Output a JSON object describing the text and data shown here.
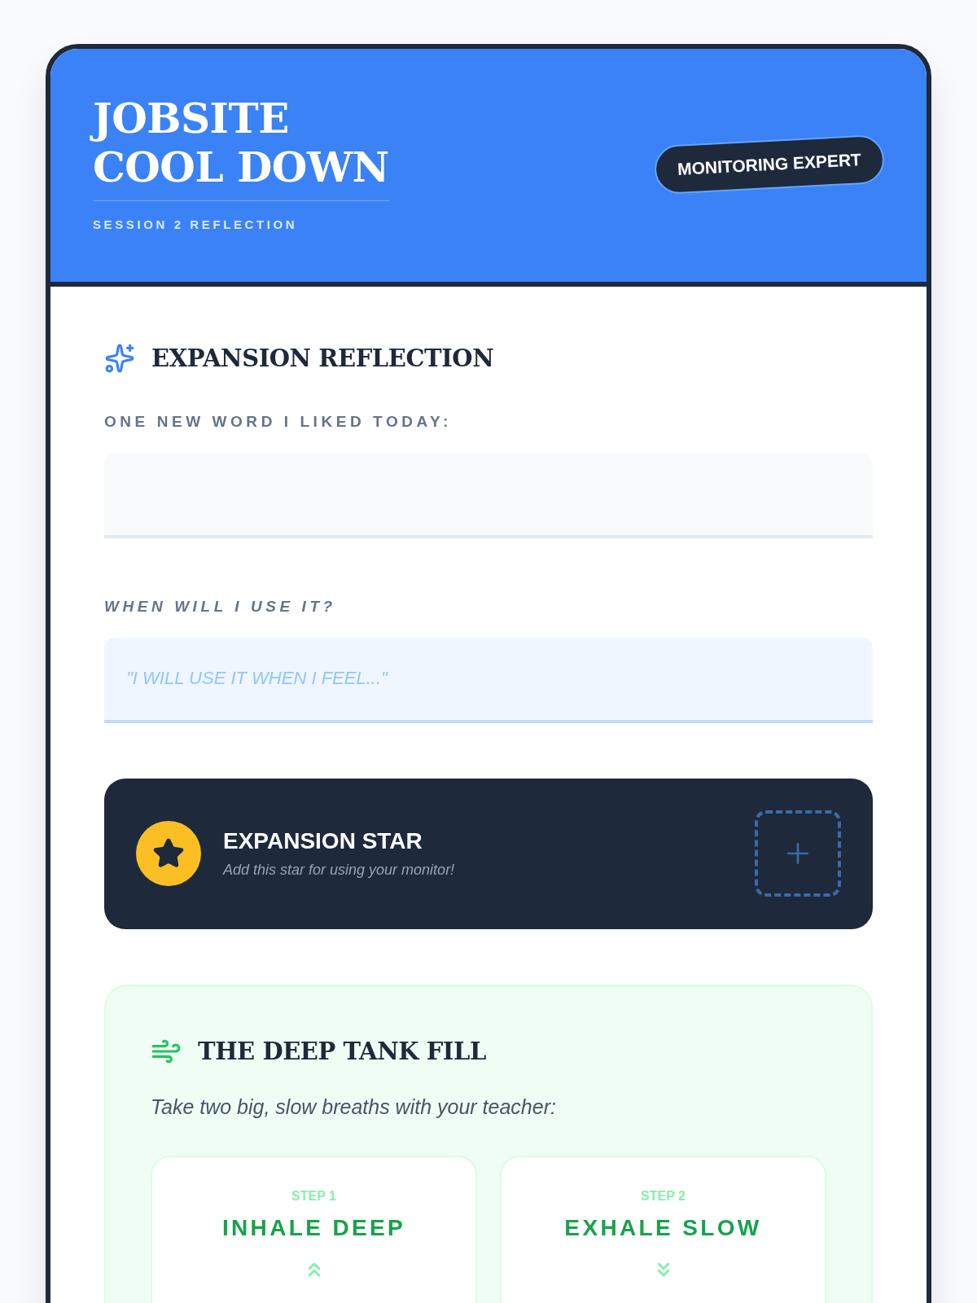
{
  "header": {
    "title_lines": [
      "JOBSITE",
      "COOL DOWN"
    ],
    "subtitle": "SESSION 2 REFLECTION",
    "badge": "MONITORING EXPERT"
  },
  "reflection": {
    "heading": "EXPANSION REFLECTION",
    "fields": [
      {
        "kind": "plain",
        "label": "ONE NEW WORD I LIKED TODAY:"
      },
      {
        "kind": "prompt",
        "label": "WHEN WILL I USE IT?",
        "placeholder": "\"I WILL USE IT WHEN I FEEL...\""
      }
    ]
  },
  "star_card": {
    "title": "EXPANSION STAR",
    "description": "Add this star for using your monitor!",
    "added": false
  },
  "breathing": {
    "heading": "THE DEEP TANK FILL",
    "instruction": "Take two big, slow breaths with your teacher:",
    "steps": [
      {
        "kind": "inhale",
        "step": "STEP 1",
        "action": "INHALE DEEP"
      },
      {
        "kind": "exhale",
        "step": "STEP 2",
        "action": "EXHALE SLOW"
      }
    ]
  }
}
